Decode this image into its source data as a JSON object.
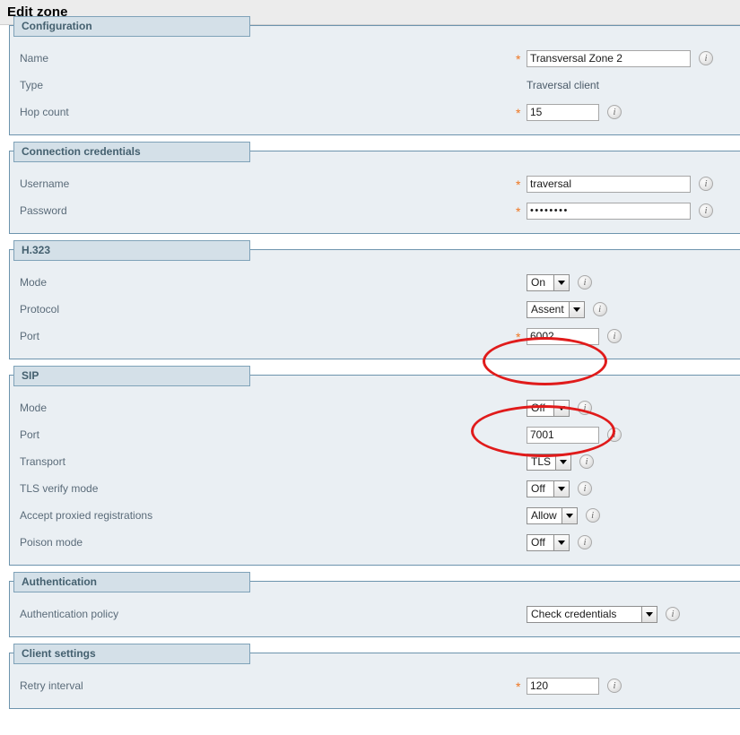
{
  "page": {
    "title": "Edit zone",
    "accent_required": "#ef7621",
    "legend_bg": "#d4e0e8",
    "panel_bg": "#eaeff3",
    "annotation_color": "#e01b1b"
  },
  "sections": [
    {
      "legend": "Configuration",
      "rows": [
        {
          "label": "Name",
          "required": true,
          "control": "text",
          "value": "Transversal Zone 2",
          "width": "wide",
          "info": true
        },
        {
          "label": "Type",
          "required": false,
          "control": "static",
          "value": "Traversal client",
          "info": false
        },
        {
          "label": "Hop count",
          "required": true,
          "control": "text",
          "value": "15",
          "width": "mid",
          "info": true
        }
      ]
    },
    {
      "legend": "Connection credentials",
      "rows": [
        {
          "label": "Username",
          "required": true,
          "control": "text",
          "value": "traversal",
          "width": "wide",
          "info": true
        },
        {
          "label": "Password",
          "required": true,
          "control": "password",
          "value": "••••••••",
          "width": "wide",
          "info": true
        }
      ]
    },
    {
      "legend": "H.323",
      "rows": [
        {
          "label": "Mode",
          "required": false,
          "control": "select",
          "value": "On",
          "info": true
        },
        {
          "label": "Protocol",
          "required": false,
          "control": "select",
          "value": "Assent",
          "info": true
        },
        {
          "label": "Port",
          "required": true,
          "control": "text",
          "value": "6002",
          "width": "mid",
          "info": true,
          "annotated": true
        }
      ]
    },
    {
      "legend": "SIP",
      "rows": [
        {
          "label": "Mode",
          "required": false,
          "control": "select",
          "value": "Off",
          "info": true,
          "annotated": true
        },
        {
          "label": "Port",
          "required": false,
          "control": "text",
          "value": "7001",
          "width": "mid",
          "info": true
        },
        {
          "label": "Transport",
          "required": false,
          "control": "select",
          "value": "TLS",
          "info": true
        },
        {
          "label": "TLS verify mode",
          "required": false,
          "control": "select",
          "value": "Off",
          "info": true
        },
        {
          "label": "Accept proxied registrations",
          "required": false,
          "control": "select",
          "value": "Allow",
          "info": true
        },
        {
          "label": "Poison mode",
          "required": false,
          "control": "select",
          "value": "Off",
          "info": true
        }
      ]
    },
    {
      "legend": "Authentication",
      "rows": [
        {
          "label": "Authentication policy",
          "required": false,
          "control": "select-wide",
          "value": "Check credentials",
          "info": true
        }
      ]
    },
    {
      "legend": "Client settings",
      "rows": [
        {
          "label": "Retry interval",
          "required": true,
          "control": "text",
          "value": "120",
          "width": "mid",
          "info": true
        }
      ]
    }
  ],
  "icons": {
    "info": "i",
    "dropdown_arrow": "chevron-down-icon"
  }
}
